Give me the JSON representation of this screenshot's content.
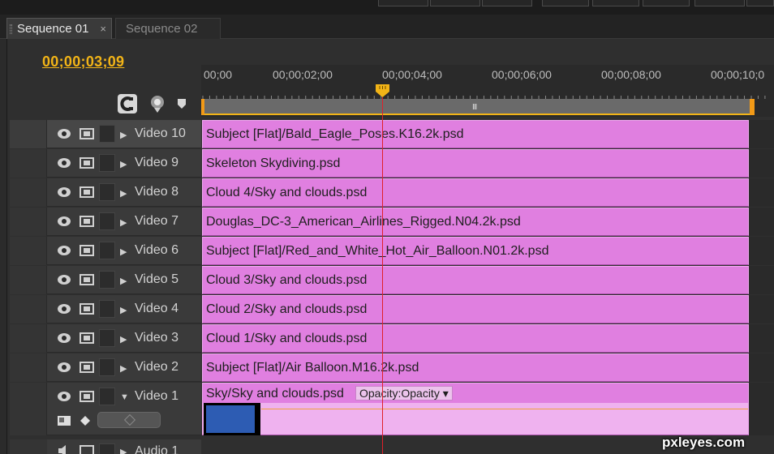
{
  "tabs": [
    {
      "label": "Sequence 01",
      "active": true,
      "close": "×"
    },
    {
      "label": "Sequence 02",
      "active": false
    }
  ],
  "timecode": "00;00;03;09",
  "ruler": {
    "labels": [
      "00;00",
      "00;00;02;00",
      "00;00;04;00",
      "00;00;06;00",
      "00;00;08;00",
      "00;00;10;0"
    ],
    "workarea_grip": "III"
  },
  "tracks": [
    {
      "name": "Video 10",
      "clip": "Subject [Flat]/Bald_Eagle_Poses.K16.2k.psd",
      "selected": true
    },
    {
      "name": "Video 9",
      "clip": "Skeleton Skydiving.psd"
    },
    {
      "name": "Video 8",
      "clip": "Cloud 4/Sky and clouds.psd"
    },
    {
      "name": "Video 7",
      "clip": "Douglas_DC-3_American_Airlines_Rigged.N04.2k.psd"
    },
    {
      "name": "Video 6",
      "clip": "Subject [Flat]/Red_and_White_Hot_Air_Balloon.N01.2k.psd"
    },
    {
      "name": "Video 5",
      "clip": "Cloud 3/Sky and clouds.psd"
    },
    {
      "name": "Video 4",
      "clip": "Cloud 2/Sky and clouds.psd"
    },
    {
      "name": "Video 3",
      "clip": "Cloud 1/Sky and clouds.psd"
    },
    {
      "name": "Video 2",
      "clip": "Subject [Flat]/Air Balloon.M16.2k.psd"
    },
    {
      "name": "Video 1",
      "clip": "Sky/Sky and clouds.psd",
      "opacity_label": "Opacity:Opacity",
      "expanded": true
    }
  ],
  "audio": {
    "name": "Audio 1"
  },
  "watermark": "pxleyes.com",
  "colors": {
    "clip": "#e07fe0",
    "timecode": "#f2b417",
    "playhead": "#e0202a",
    "workarea_edge": "#f29a17"
  }
}
